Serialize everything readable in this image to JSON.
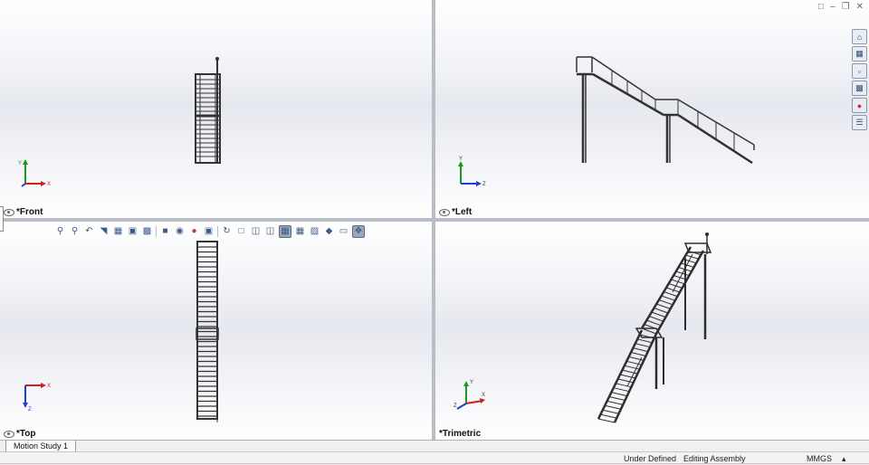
{
  "viewports": {
    "front": {
      "label": "*Front",
      "triad_axes": [
        "Y",
        "X"
      ]
    },
    "left": {
      "label": "*Left",
      "triad_axes": [
        "Y",
        "Z"
      ]
    },
    "top": {
      "label": "*Top",
      "triad_axes": [
        "X",
        "Z"
      ]
    },
    "trimetric": {
      "label": "*Trimetric",
      "triad_axes": [
        "Y",
        "X",
        "Z"
      ]
    }
  },
  "heads_up_toolbar": {
    "icons": [
      "zoom-to-fit-icon",
      "zoom-to-area-icon",
      "previous-view-icon",
      "section-view-icon",
      "dynamic-annotation-icon",
      "view-orientation-icon",
      "display-style-icon",
      "hide-show-items-icon",
      "edit-appearance-icon",
      "apply-scene-icon",
      "view-settings-icon",
      "rotate-icon",
      "single-view-icon",
      "two-view-horizontal-icon",
      "two-view-vertical-icon",
      "four-view-icon",
      "link-views-icon",
      "shaded-icon",
      "display-pane-icon",
      "viewport-icon"
    ]
  },
  "task_pane": {
    "icons": [
      "home-icon",
      "design-library-icon",
      "file-explorer-icon",
      "view-palette-icon",
      "appearances-icon",
      "custom-properties-icon"
    ]
  },
  "window_controls": [
    "restore-icon",
    "minimize-icon",
    "maximize-icon",
    "close-icon"
  ],
  "model_tabs": {
    "motion_study": "Motion Study 1"
  },
  "status_bar": {
    "state": "Under Defined",
    "mode": "Editing Assembly",
    "units": "MMGS",
    "units_arrow": "▴"
  },
  "colors": {
    "x_axis": "#d01f1f",
    "y_axis": "#1a9a1a",
    "z_axis": "#1f3fd0",
    "model": "#2e2e2e"
  }
}
